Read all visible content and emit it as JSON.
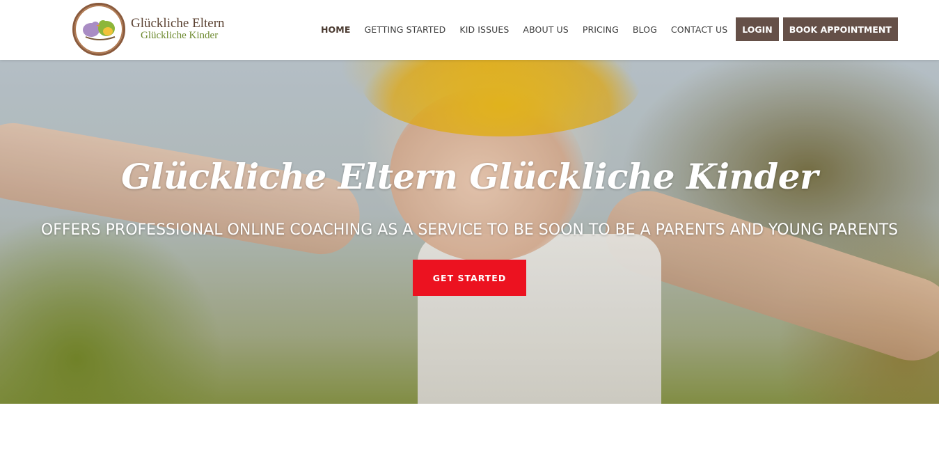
{
  "brand": {
    "title": "Glückliche Eltern",
    "subtitle": "Glückliche Kinder",
    "colors": {
      "brown": "#655048",
      "green": "#6d8a2f",
      "accent_red": "#ec1220"
    }
  },
  "nav": {
    "items": [
      {
        "label": "HOME",
        "active": true
      },
      {
        "label": "GETTING STARTED"
      },
      {
        "label": "KID ISSUES"
      },
      {
        "label": "ABOUT US"
      },
      {
        "label": "PRICING"
      },
      {
        "label": "BLOG"
      },
      {
        "label": "CONTACT US"
      }
    ],
    "login_label": "LOGIN",
    "book_label": "BOOK APPOINTMENT"
  },
  "hero": {
    "title": "Glückliche Eltern Glückliche Kinder",
    "subtitle": "OFFERS PROFESSIONAL ONLINE COACHING AS A SERVICE TO BE SOON TO BE A PARENTS AND YOUNG PARENTS",
    "cta_label": "GET STARTED"
  }
}
